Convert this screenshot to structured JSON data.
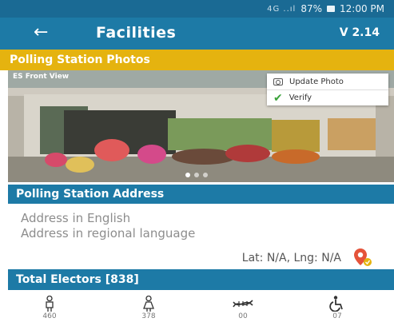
{
  "status_bar": {
    "signal": "4G ..ıl",
    "battery": "87%",
    "time": "12:00 PM"
  },
  "app_bar": {
    "back_icon": "arrow-left-icon",
    "title": "Facilities",
    "version": "V 2.14"
  },
  "photos_section": {
    "title": "Polling Station Photos",
    "photo_tag": "ES Front View",
    "menu": {
      "update_label": "Update Photo",
      "verify_label": "Verify"
    },
    "carousel_dots": 3,
    "active_dot": 1
  },
  "address_section": {
    "title": "Polling Station Address",
    "english_placeholder": "Address in English",
    "regional_placeholder": "Address in regional language",
    "latlng": "Lat: N/A, Lng: N/A",
    "pin_color": "#e5533a"
  },
  "electors_section": {
    "title": "Total Electors [838]",
    "categories": [
      {
        "icon": "male-icon",
        "count": "460"
      },
      {
        "icon": "female-icon",
        "count": "378"
      },
      {
        "icon": "third-gender-icon",
        "count": "00"
      },
      {
        "icon": "wheelchair-icon",
        "count": "07"
      }
    ]
  },
  "colors": {
    "primary": "#1d7aa6",
    "accent": "#e5b30f"
  }
}
